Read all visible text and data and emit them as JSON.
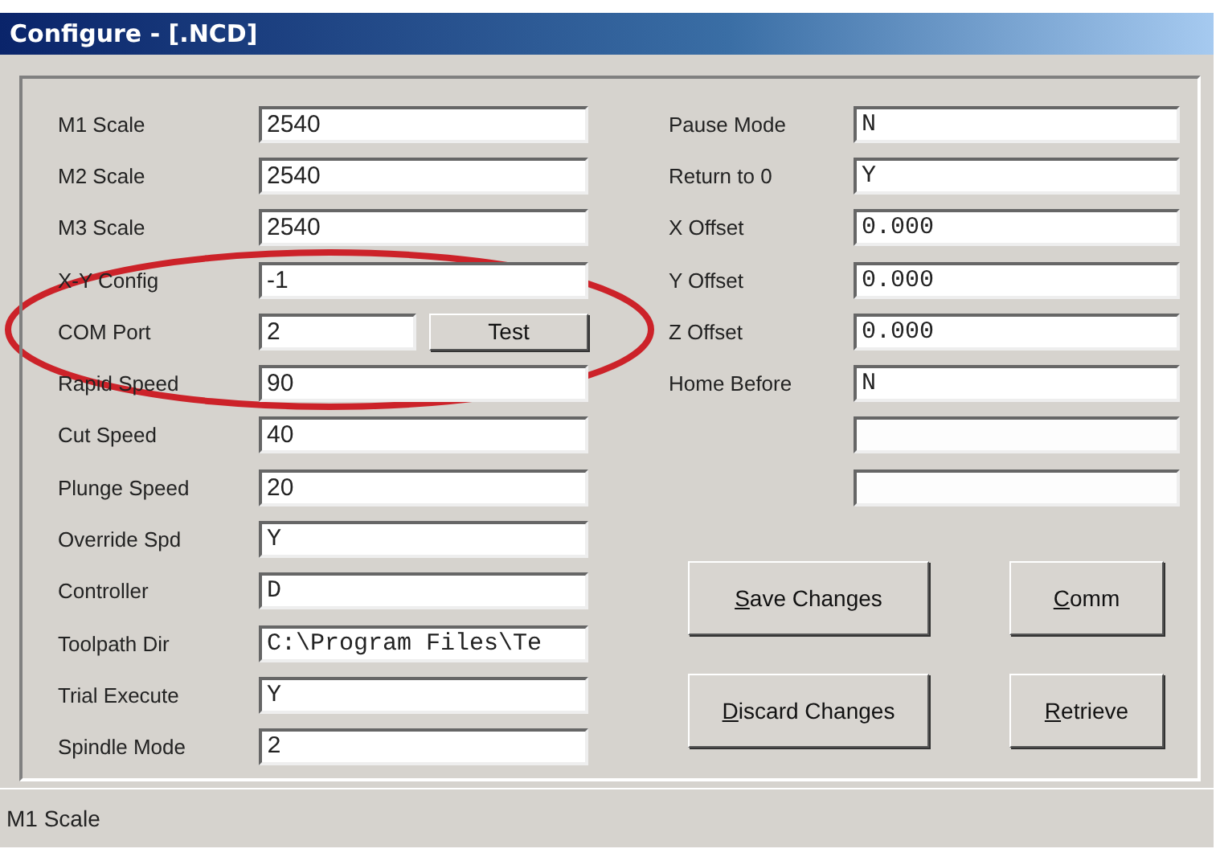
{
  "window": {
    "title": "Configure - [.NCD]"
  },
  "left_fields": [
    {
      "label": "M1 Scale",
      "value": "2540",
      "monospace": false
    },
    {
      "label": "M2 Scale",
      "value": "2540",
      "monospace": false
    },
    {
      "label": "M3 Scale",
      "value": "2540",
      "monospace": false
    },
    {
      "label": "X-Y Config",
      "value": "-1",
      "monospace": false
    },
    {
      "label": "COM Port",
      "value": "2",
      "monospace": false,
      "button": "Test"
    },
    {
      "label": "Rapid Speed",
      "value": "90",
      "monospace": false
    },
    {
      "label": "Cut Speed",
      "value": "40",
      "monospace": false
    },
    {
      "label": "Plunge Speed",
      "value": "20",
      "monospace": false
    },
    {
      "label": "Override Spd",
      "value": "Y",
      "monospace": true
    },
    {
      "label": "Controller",
      "value": "D",
      "monospace": true
    },
    {
      "label": "Toolpath Dir",
      "value": "C:\\Program Files\\Te",
      "monospace": true
    },
    {
      "label": "Trial Execute",
      "value": "Y",
      "monospace": true
    },
    {
      "label": "Spindle Mode",
      "value": "2",
      "monospace": true
    }
  ],
  "right_fields": [
    {
      "kind": "labeled",
      "label": "Pause Mode",
      "value": "N",
      "monospace": true
    },
    {
      "kind": "labeled",
      "label": "Return to 0",
      "value": "Y",
      "monospace": true
    },
    {
      "kind": "labeled",
      "label": "X Offset",
      "value": "0.000",
      "monospace": true
    },
    {
      "kind": "labeled",
      "label": "Y Offset",
      "value": "0.000",
      "monospace": true
    },
    {
      "kind": "labeled",
      "label": "Z Offset",
      "value": "0.000",
      "monospace": true
    },
    {
      "kind": "labeled",
      "label": "Home Before",
      "value": "N",
      "monospace": true
    },
    {
      "kind": "blank"
    },
    {
      "kind": "blank"
    }
  ],
  "buttons": [
    {
      "label": "Save Changes",
      "underline_first": true
    },
    {
      "label": "Comm",
      "underline_first": true
    },
    {
      "label": "Discard Changes",
      "underline_first": true
    },
    {
      "label": "Retrieve",
      "underline_first": true
    }
  ],
  "status_bar": "M1 Scale"
}
